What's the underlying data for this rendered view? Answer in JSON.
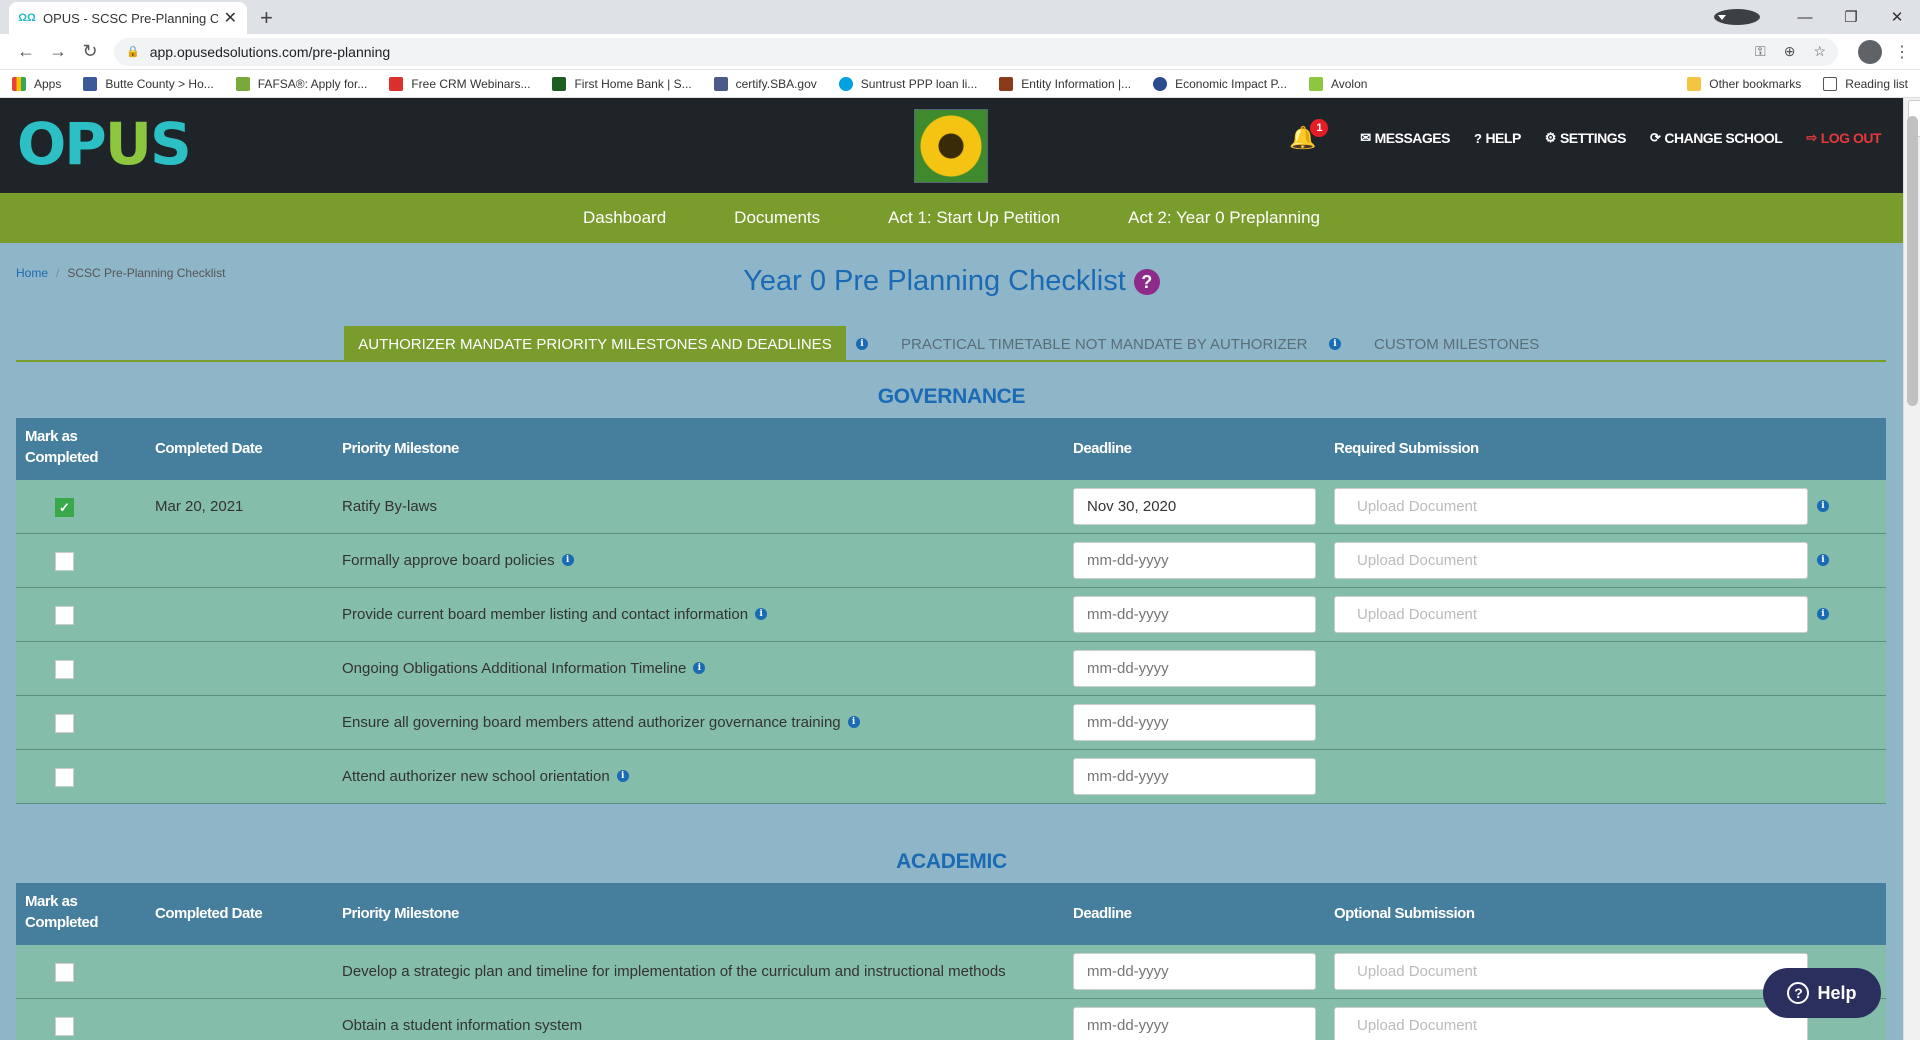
{
  "browser": {
    "tab_title": "OPUS - SCSC Pre-Planning Check",
    "url": "app.opusedsolutions.com/pre-planning",
    "bookmarks": [
      "Apps",
      "Butte County > Ho...",
      "FAFSA®: Apply for...",
      "Free CRM Webinars...",
      "First Home Bank | S...",
      "certify.SBA.gov",
      "Suntrust PPP loan li...",
      "Entity Information |...",
      "Economic Impact P...",
      "Avolon"
    ],
    "bookmarks_right": [
      "Other bookmarks",
      "Reading list"
    ]
  },
  "header": {
    "logo_left": "OP",
    "logo_u": "U",
    "logo_right": "S",
    "notification_count": "1",
    "nav": [
      "MESSAGES",
      "HELP",
      "SETTINGS",
      "CHANGE SCHOOL",
      "LOG OUT"
    ]
  },
  "main_nav": [
    "Dashboard",
    "Documents",
    "Act 1: Start Up Petition",
    "Act 2: Year 0 Preplanning"
  ],
  "breadcrumb": {
    "home": "Home",
    "current": "SCSC Pre-Planning Checklist"
  },
  "page_title": "Year 0 Pre Planning Checklist",
  "tabs": [
    "AUTHORIZER MANDATE PRIORITY MILESTONES AND DEADLINES",
    "PRACTICAL TIMETABLE NOT MANDATE BY AUTHORIZER",
    "CUSTOM MILESTONES"
  ],
  "governance": {
    "title": "GOVERNANCE",
    "headers": {
      "mark": "Mark as Completed",
      "completed": "Completed Date",
      "milestone": "Priority Milestone",
      "deadline": "Deadline",
      "submission": "Required Submission"
    },
    "rows": [
      {
        "checked": true,
        "completed": "Mar 20, 2021",
        "milestone": "Ratify By-laws",
        "deadline": "Nov 30, 2020",
        "upload": true,
        "info": false
      },
      {
        "checked": false,
        "completed": "",
        "milestone": "Formally approve board policies",
        "deadline": "",
        "upload": true,
        "info": true
      },
      {
        "checked": false,
        "completed": "",
        "milestone": "Provide current board member listing and contact information",
        "deadline": "",
        "upload": true,
        "info": true
      },
      {
        "checked": false,
        "completed": "",
        "milestone": "Ongoing Obligations Additional Information Timeline",
        "deadline": "",
        "upload": false,
        "info": true
      },
      {
        "checked": false,
        "completed": "",
        "milestone": "Ensure all governing board members attend authorizer governance training",
        "deadline": "",
        "upload": false,
        "info": true
      },
      {
        "checked": false,
        "completed": "",
        "milestone": "Attend authorizer new school orientation",
        "deadline": "",
        "upload": false,
        "info": true
      }
    ]
  },
  "academic": {
    "title": "ACADEMIC",
    "headers": {
      "mark": "Mark as Completed",
      "completed": "Completed Date",
      "milestone": "Priority Milestone",
      "deadline": "Deadline",
      "submission": "Optional Submission"
    },
    "rows": [
      {
        "checked": false,
        "completed": "",
        "milestone": "Develop a strategic plan and timeline for implementation of the curriculum and instructional methods",
        "deadline": "",
        "upload": true,
        "info": false
      },
      {
        "checked": false,
        "completed": "",
        "milestone": "Obtain a student information system",
        "deadline": "",
        "upload": true,
        "info": false
      }
    ]
  },
  "date_placeholder": "mm-dd-yyyy",
  "upload_placeholder": "Upload Document",
  "help_button": "Help"
}
